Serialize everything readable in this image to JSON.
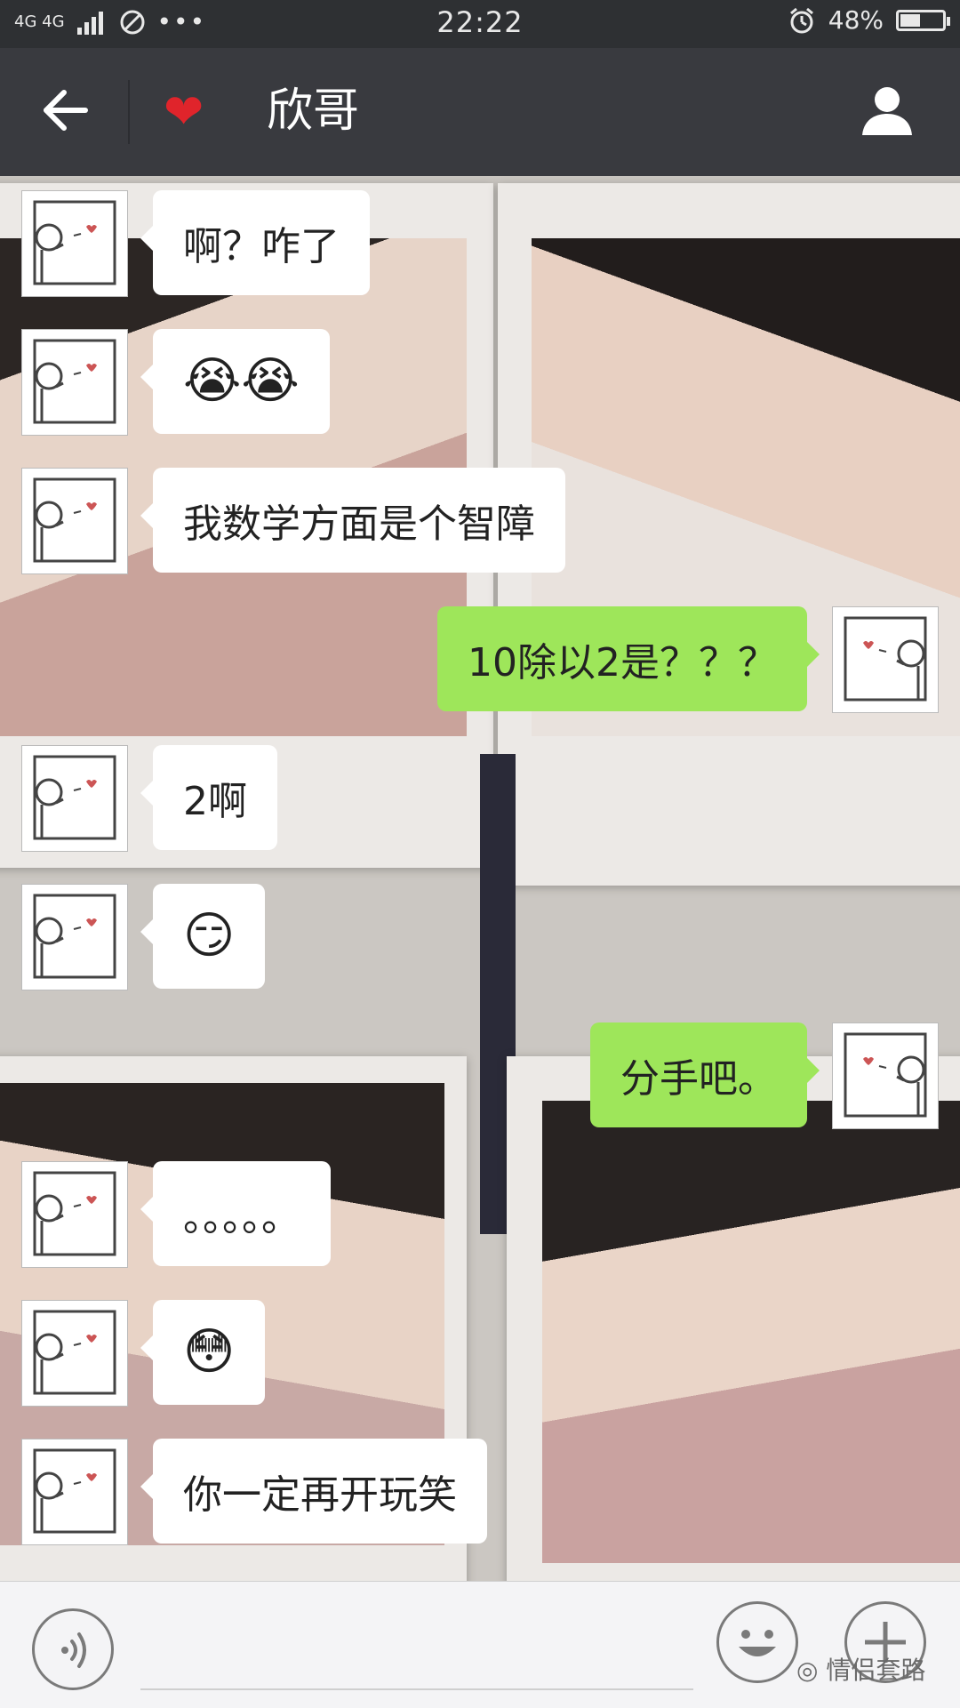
{
  "status_bar": {
    "network": "4G 4G",
    "time": "22:22",
    "battery": "48%",
    "battery_level": 0.48
  },
  "header": {
    "title": "欣哥",
    "heart": "❤"
  },
  "messages": [
    {
      "side": "in",
      "text": "啊？咋了"
    },
    {
      "side": "in",
      "text": "😭😭"
    },
    {
      "side": "in",
      "text": "我数学方面是个智障"
    },
    {
      "side": "out",
      "text": "10除以2是？？？"
    },
    {
      "side": "in",
      "text": "2啊"
    },
    {
      "side": "in",
      "text": "😏"
    },
    {
      "side": "out",
      "text": "分手吧。"
    },
    {
      "side": "in",
      "text": "。。。。。"
    },
    {
      "side": "in",
      "text": "😳"
    },
    {
      "side": "in",
      "text": "你一定再开玩笑"
    }
  ],
  "watermark": "情侣套路",
  "colors": {
    "header_bg": "#393a3f",
    "status_bg": "#2e3033",
    "out_bubble": "#9ee65a",
    "in_bubble": "#ffffff"
  }
}
